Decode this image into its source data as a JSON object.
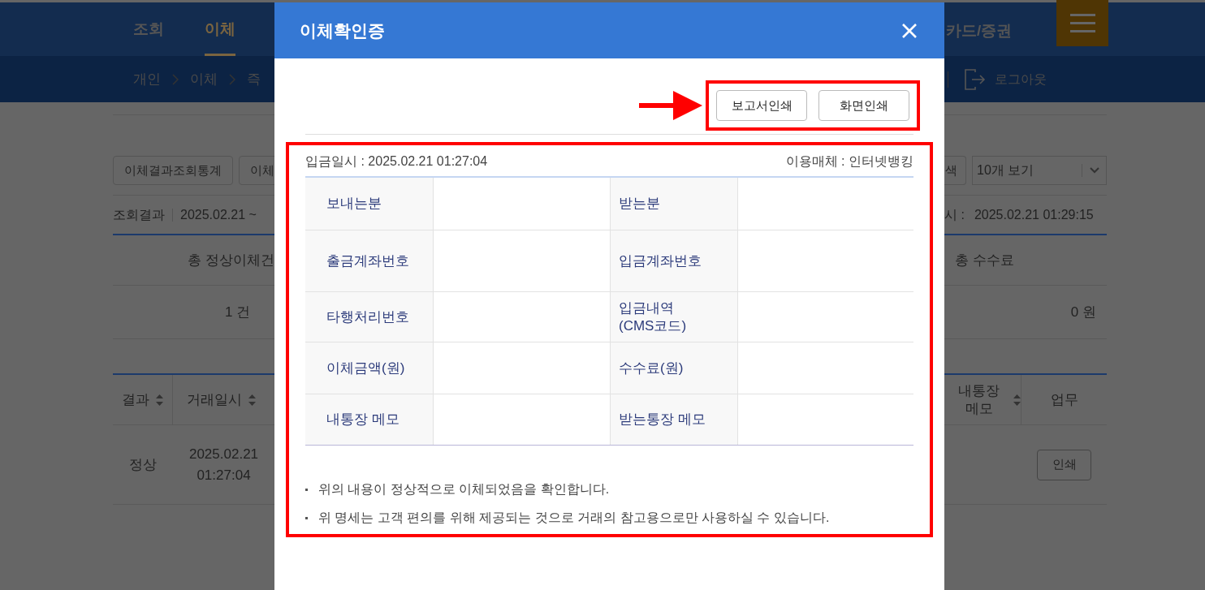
{
  "background_page": {
    "nav": [
      {
        "label": "조회",
        "selected": false
      },
      {
        "label": "이체",
        "selected": true
      }
    ],
    "nav_right": "카드/증권",
    "breadcrumb": [
      "개인",
      "이체",
      "즉"
    ],
    "logout": "로그아웃",
    "tool_buttons": [
      "이체결과조회통계",
      "이체"
    ],
    "search_button": "색",
    "page_size": "10개 보기",
    "result_label": "조회결과",
    "result_range": "2025.02.21 ~",
    "query_time_label": "시 :",
    "query_time": "2025.02.21 01:29:15",
    "summary": {
      "left_column": "총 정상이체건",
      "left_value": "1 건",
      "right_column": "총 수수료",
      "right_value": "0 원"
    },
    "list_columns_left": [
      {
        "label": "결과",
        "sortable": true
      },
      {
        "label": "거래일시",
        "sortable": true
      }
    ],
    "list_columns_right": [
      {
        "label": "내통장 메모",
        "sortable": true
      },
      {
        "label": "업무",
        "sortable": false
      }
    ],
    "list_row": {
      "result": "정상",
      "date": "2025.02.21",
      "time": "01:27:04",
      "action": "인쇄"
    }
  },
  "modal": {
    "title": "이체확인증",
    "print_buttons": [
      "보고서인쇄",
      "화면인쇄"
    ],
    "deposit_time": "입금일시 : 2025.02.21 01:27:04",
    "channel": "이용매체 : 인터넷뱅킹",
    "rows": [
      {
        "left": "보내는분",
        "right": "받는분"
      },
      {
        "left": "출금계좌번호",
        "right": "입금계좌번호"
      },
      {
        "left": "타행처리번호",
        "right": "입금내역\n(CMS코드)"
      },
      {
        "left": "이체금액(원)",
        "right": "수수료(원)"
      },
      {
        "left": "내통장 메모",
        "right": "받는통장 메모"
      }
    ],
    "notes": [
      "위의 내용이 정상적으로 이체되었음을 확인합니다.",
      "위 명세는 고객 편의를 위해 제공되는 것으로 거래의 참고용으로만 사용하실 수 있습니다."
    ]
  }
}
